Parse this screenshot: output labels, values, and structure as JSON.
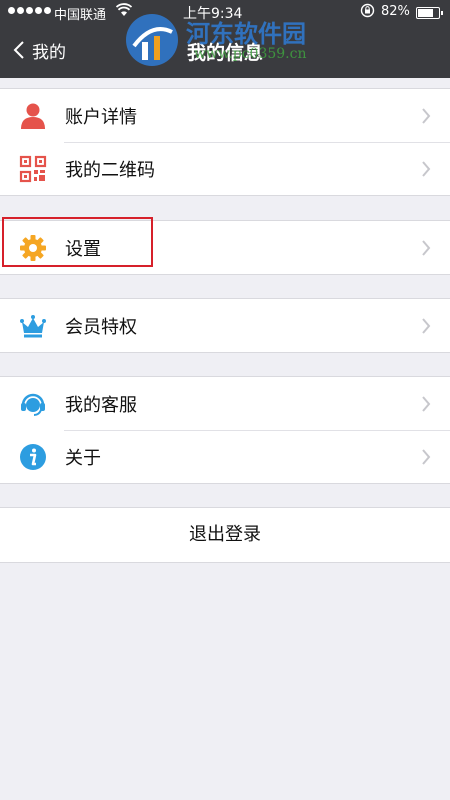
{
  "status_bar": {
    "carrier": "中国联通",
    "time": "上午9:34",
    "battery_percent": "82%",
    "battery_level": 0.82
  },
  "nav": {
    "back_label": "我的",
    "title": "我的信息"
  },
  "watermark": {
    "text": "河东软件园",
    "url": "www.pc0359.cn"
  },
  "menu_groups": [
    {
      "items": [
        {
          "label": "账户详情",
          "icon": "user-icon"
        },
        {
          "label": "我的二维码",
          "icon": "qr-code-icon"
        }
      ]
    },
    {
      "items": [
        {
          "label": "设置",
          "icon": "gear-icon"
        }
      ]
    },
    {
      "items": [
        {
          "label": "会员特权",
          "icon": "crown-icon"
        }
      ]
    },
    {
      "items": [
        {
          "label": "我的客服",
          "icon": "customer-service-icon"
        },
        {
          "label": "关于",
          "icon": "info-icon"
        }
      ]
    }
  ],
  "logout_label": "退出登录",
  "colors": {
    "header_bg": "#3a3b3f",
    "page_bg": "#efeff4",
    "user_icon": "#e5534b",
    "gear_icon": "#f5a623",
    "blue_icon": "#2d9de0",
    "highlight": "#d6202a"
  }
}
